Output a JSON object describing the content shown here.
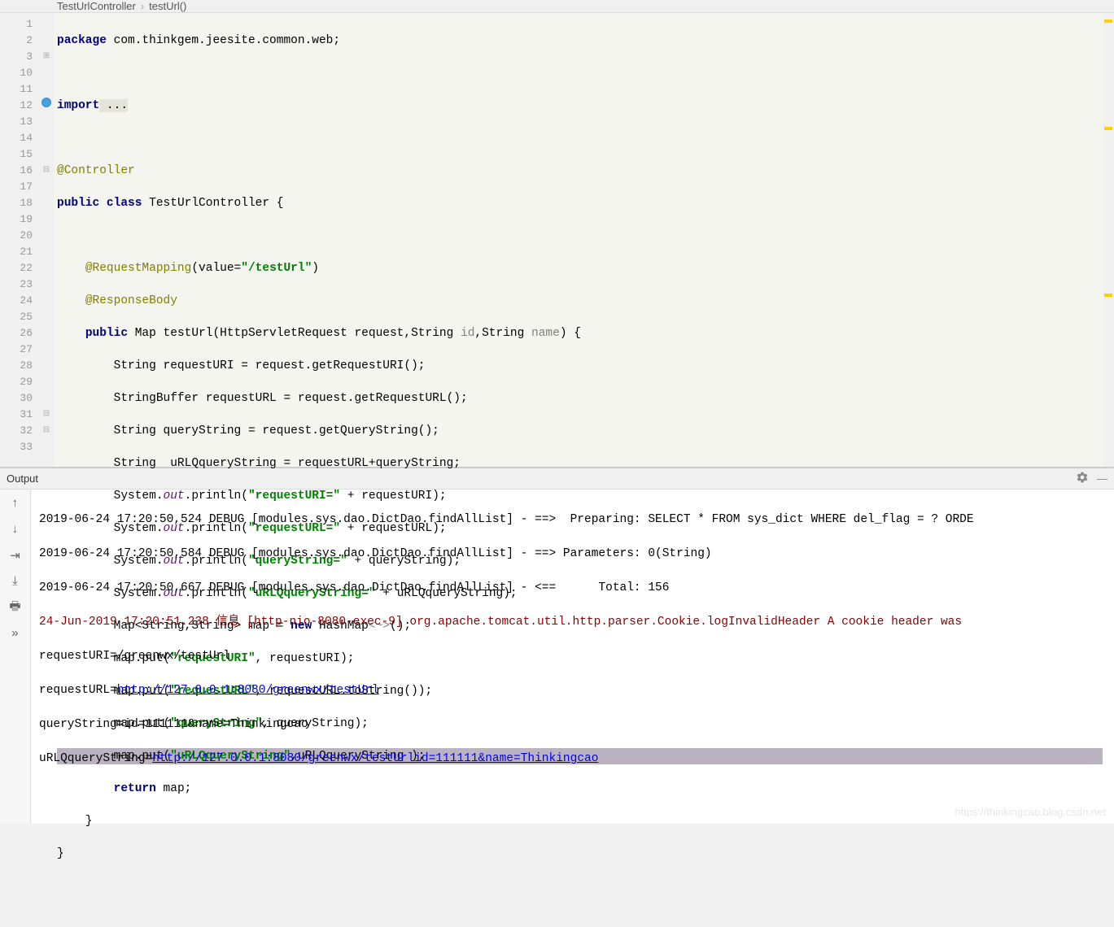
{
  "breadcrumb": {
    "class": "TestUrlController",
    "method": "testUrl()"
  },
  "line_numbers": [
    "1",
    "2",
    "3",
    "10",
    "11",
    "12",
    "13",
    "14",
    "15",
    "16",
    "17",
    "18",
    "19",
    "20",
    "21",
    "22",
    "23",
    "24",
    "25",
    "26",
    "27",
    "28",
    "29",
    "30",
    "31",
    "32",
    "33"
  ],
  "code": {
    "package_kw": "package",
    "package_name": " com.thinkgem.jeesite.common.web;",
    "import_kw": "import",
    "import_rest": " ...",
    "anno_controller": "@Controller",
    "public_kw": "public",
    "class_kw": "class",
    "class_name": " TestUrlController {",
    "anno_req": "@RequestMapping",
    "anno_req_args": "(value=",
    "anno_req_val": "\"/testUrl\"",
    "anno_req_end": ")",
    "anno_resp": "@ResponseBody",
    "method_sig_1": " Map testUrl(HttpServletRequest request,String ",
    "method_sig_id": "id",
    "method_sig_2": ",String ",
    "method_sig_name": "name",
    "method_sig_3": ") {",
    "l17": "        String requestURI = request.getRequestURI();",
    "l18": "        StringBuffer requestURL = request.getRequestURL();",
    "l19": "        String queryString = request.getQueryString();",
    "l20": "        String  uRLQqueryString = requestURL+queryString;",
    "l21a": "        System.",
    "l21b": "out",
    "l21c": ".println(",
    "l21s": "\"requestURI=\"",
    "l21d": " + requestURI);",
    "l22a": "        System.",
    "l22b": "out",
    "l22c": ".println(",
    "l22s": "\"requestURL=\"",
    "l22d": " + requestURL);",
    "l23a": "        System.",
    "l23b": "out",
    "l23c": ".println(",
    "l23s": "\"queryString=\"",
    "l23d": " + queryString);",
    "l24a": "        System.",
    "l24b": "out",
    "l24c": ".println(",
    "l24s": "\"uRLQqueryString=\"",
    "l24d": " + uRLQqueryString);",
    "l25a": "        Map<String,String> map = ",
    "l25new": "new",
    "l25b": " HashMap",
    "l25diamond": "<~>",
    "l25c": "();",
    "l26a": "        map.put(",
    "l26s": "\"requestURI\"",
    "l26b": ", requestURI);",
    "l27a": "        map.put(",
    "l27s": "\"requestURL\"",
    "l27b": ", requestURL.toString());",
    "l28a": "        map.put(",
    "l28s": "\"queryString\"",
    "l28b": ", queryString);",
    "l29a": "        map.put(",
    "l29s": "\"uRLQqueryString\"",
    "l29b": ",uRLQqueryString );",
    "l30a": "        ",
    "l30ret": "return",
    "l30b": " map;",
    "l31": "    }",
    "l32": "}",
    "l33": ""
  },
  "output": {
    "title": "Output",
    "lines": [
      "2019-06-24 17:20:50,524 DEBUG [modules.sys.dao.DictDao.findAllList] - ==>  Preparing: SELECT * FROM sys_dict WHERE del_flag = ? ORDE",
      "2019-06-24 17:20:50,584 DEBUG [modules.sys.dao.DictDao.findAllList] - ==> Parameters: 0(String)",
      "2019-06-24 17:20:50,667 DEBUG [modules.sys.dao.DictDao.findAllList] - <==      Total: 156"
    ],
    "info_line": "24-Jun-2019 17:20:51.238 信息 [http-nio-8080-exec-9] org.apache.tomcat.util.http.parser.Cookie.logInvalidHeader A cookie header was ",
    "l5": "requestURI=/greenwx/testUrl",
    "l6_pre": "requestURL=",
    "l6_url": "http://127.0.0.1:8080/greenwx/testUrl",
    "l7": "queryString=id=111111&name=Thinkingcao",
    "l8_pre": "uRLQqueryString=",
    "l8_url": "http://127.0.0.1:8080/greenwx/testUrlid=111111&name=Thinkingcao"
  },
  "watermark": "https://thinkingcao.blog.csdn.net"
}
